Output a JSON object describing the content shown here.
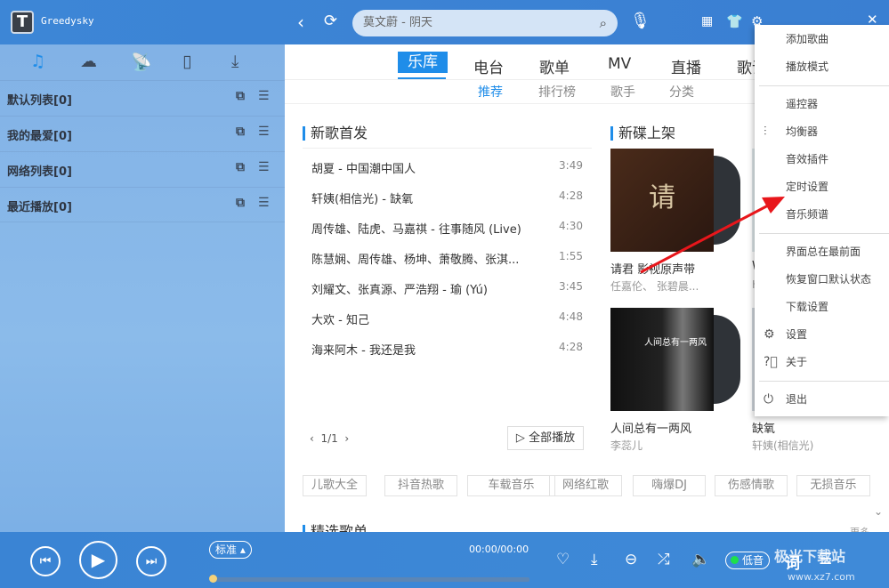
{
  "app": {
    "name": "Greedysky",
    "logo_letter": "T"
  },
  "search": {
    "value": "莫文蔚 - 阴天"
  },
  "sidebar": {
    "tabs": [
      "music-note",
      "cloud",
      "radio",
      "device",
      "download"
    ],
    "playlists": [
      {
        "label": "默认列表[0]"
      },
      {
        "label": "我的最爱[0]"
      },
      {
        "label": "网络列表[0]"
      },
      {
        "label": "最近播放[0]"
      }
    ]
  },
  "nav": {
    "tabs": [
      "乐库",
      "电台",
      "歌单",
      "MV",
      "直播",
      "歌词"
    ],
    "active": "乐库",
    "sub": [
      "推荐",
      "排行榜",
      "歌手",
      "分类"
    ],
    "sub_active": "推荐"
  },
  "new_songs": {
    "title": "新歌首发",
    "items": [
      {
        "name": "胡夏 - 中国潮中国人",
        "dur": "3:49"
      },
      {
        "name": "轩姨(相信光) - 缺氧",
        "dur": "4:28"
      },
      {
        "name": "周传雄、陆虎、马嘉祺 - 往事随风 (Live)",
        "dur": "4:30"
      },
      {
        "name": "陈慧娴、周传雄、杨坤、萧敬腾、张淇...",
        "dur": "1:55"
      },
      {
        "name": "刘耀文、张真源、严浩翔 - 瑜 (Yú)",
        "dur": "3:45"
      },
      {
        "name": "大欢 - 知己",
        "dur": "4:48"
      },
      {
        "name": "海来阿木 - 我还是我",
        "dur": "4:28"
      }
    ],
    "page": "1/1",
    "play_all": "全部播放"
  },
  "new_albums": {
    "title": "新碟上架",
    "items": [
      {
        "title": "请君 影视原声带",
        "artist": "任嘉伦、 张碧晨...",
        "cover_text": "请君"
      },
      {
        "title": "W",
        "artist": "H"
      },
      {
        "title": "人间总有一两风",
        "artist": "李蕊儿",
        "cover_text": "人间总有一两风"
      },
      {
        "title": "缺氧",
        "artist": "轩姨(相信光)"
      }
    ]
  },
  "tags": [
    "儿歌大全",
    "抖音热歌",
    "车载音乐",
    "网络红歌",
    "嗨爆DJ",
    "伤感情歌",
    "无损音乐"
  ],
  "featured": {
    "title": "精选歌单",
    "more": "更多"
  },
  "player": {
    "quality": "标准",
    "time": "00:00/00:00",
    "sound_quality": "低音",
    "lyric": "词",
    "progress": 0
  },
  "menu": {
    "items": [
      {
        "label": "添加歌曲",
        "icon": ""
      },
      {
        "label": "播放模式",
        "icon": ""
      },
      {
        "sep": true
      },
      {
        "label": "遥控器",
        "icon": ""
      },
      {
        "label": "均衡器",
        "icon": "equalizer-icon"
      },
      {
        "label": "音效插件",
        "icon": ""
      },
      {
        "label": "定时设置",
        "icon": ""
      },
      {
        "label": "音乐频谱",
        "icon": ""
      },
      {
        "sep": true
      },
      {
        "label": "界面总在最前面",
        "icon": ""
      },
      {
        "label": "恢复窗口默认状态",
        "icon": ""
      },
      {
        "label": "下载设置",
        "icon": ""
      },
      {
        "label": "设置",
        "icon": "gear-icon"
      },
      {
        "label": "关于",
        "icon": "help-icon"
      },
      {
        "sep": true
      },
      {
        "label": "退出",
        "icon": "power-icon"
      }
    ]
  },
  "watermark": {
    "text": "极光下载站",
    "url": "www.xz7.com"
  },
  "colors": {
    "accent": "#1f8de9",
    "titlebar": "#3d86d6",
    "annotation_arrow": "#e8161b"
  }
}
